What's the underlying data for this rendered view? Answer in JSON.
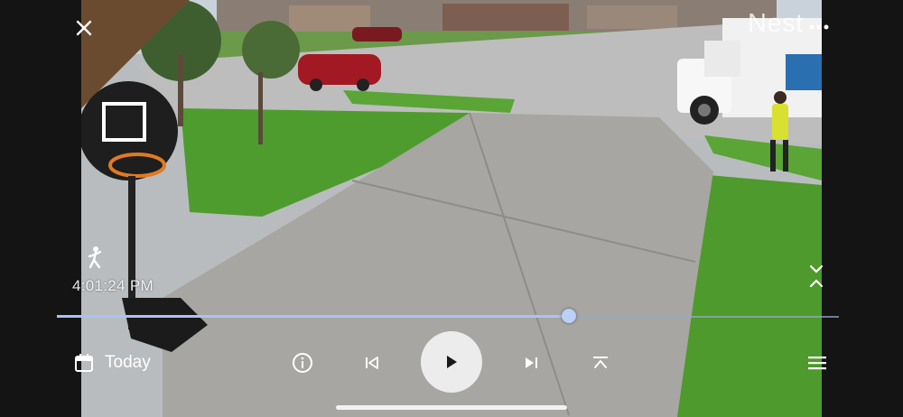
{
  "header": {
    "brand": "Nest",
    "close_icon": "close-icon",
    "more_icon": "more-vert-icon"
  },
  "overlay": {
    "motion_icon": "person-motion-icon",
    "timestamp": "4:01:24 PM",
    "jump_icon": "jump-to-event-icon"
  },
  "playback": {
    "progress_fraction": 0.655
  },
  "controls": {
    "date_label": "Today",
    "calendar_icon": "calendar-icon",
    "info_icon": "info-icon",
    "prev_icon": "skip-previous-icon",
    "play_icon": "play-icon",
    "next_icon": "skip-next-icon",
    "collapse_icon": "collapse-up-icon",
    "menu_icon": "menu-icon"
  },
  "colors": {
    "accent": "#b9d0f7",
    "play_button_bg": "#ececec"
  }
}
